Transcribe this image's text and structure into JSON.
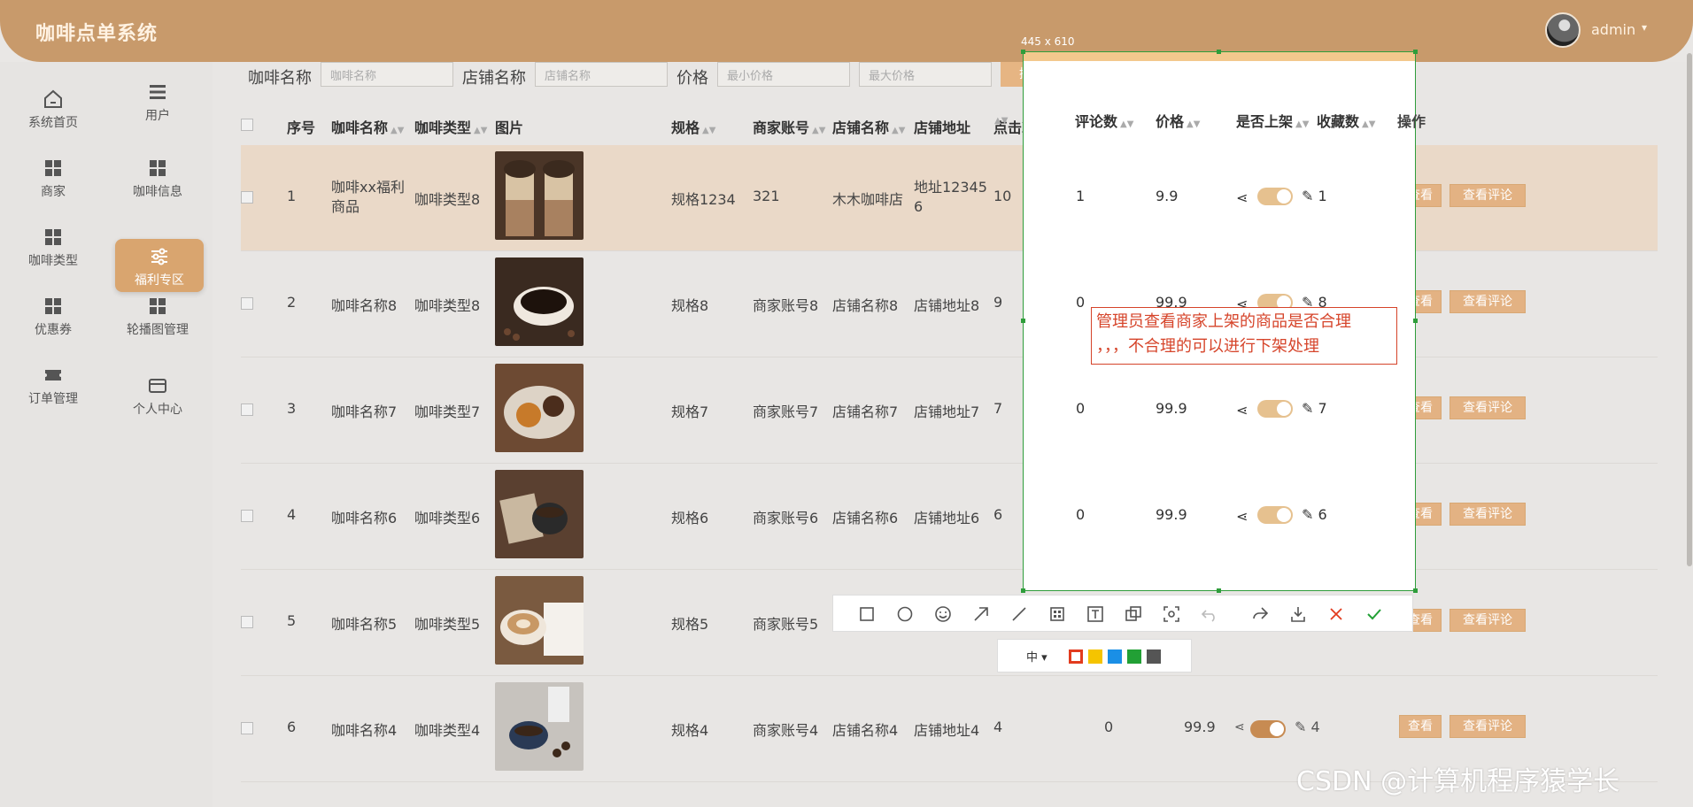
{
  "header": {
    "title": "咖啡点单系统",
    "user": "admin",
    "caret": "▾"
  },
  "sidebar": {
    "items": [
      {
        "label": "系统首页",
        "icon": "home-icon"
      },
      {
        "label": "用户",
        "icon": "menu-icon"
      },
      {
        "label": "商家",
        "icon": "grid-icon"
      },
      {
        "label": "咖啡信息",
        "icon": "grid-icon"
      },
      {
        "label": "咖啡类型",
        "icon": "grid-icon"
      },
      {
        "label": "福利专区",
        "icon": "sliders-icon"
      },
      {
        "label": "优惠券",
        "icon": "grid-icon"
      },
      {
        "label": "轮播图管理",
        "icon": "grid-icon"
      },
      {
        "label": "订单管理",
        "icon": "ticket-icon"
      },
      {
        "label": "个人中心",
        "icon": "card-icon"
      }
    ]
  },
  "search": {
    "coffee_name_label": "咖啡名称",
    "coffee_name_placeholder": "咖啡名称",
    "shop_name_label": "店铺名称",
    "shop_name_placeholder": "店铺名称",
    "price_label": "价格",
    "min_price_placeholder": "最小价格",
    "max_price_placeholder": "最大价格",
    "search_button": "搜索"
  },
  "table": {
    "headers": {
      "index": "序号",
      "name": "咖啡名称",
      "type": "咖啡类型",
      "image": "图片",
      "spec": "规格",
      "merchant": "商家账号",
      "shop": "店铺名称",
      "address": "店铺地址",
      "clicks": "点击次数",
      "comments": "评论数",
      "price": "价格",
      "listed": "是否上架",
      "favorites": "收藏数",
      "actions": "操作"
    },
    "view_label": "查看",
    "comment_label": "查看评论",
    "rows": [
      {
        "index": "1",
        "name_line1": "咖啡xx福利",
        "name_line2": "商品",
        "type": "咖啡类型8",
        "spec": "规格1234",
        "merchant": "321",
        "shop": "木木咖啡店",
        "addr_line1": "地址12345",
        "addr_line2": "6",
        "clicks": "10",
        "comments": "1",
        "price": "9.9",
        "favorites": "1"
      },
      {
        "index": "2",
        "name_line1": "咖啡名称8",
        "name_line2": "",
        "type": "咖啡类型8",
        "spec": "规格8",
        "merchant": "商家账号8",
        "shop": "店铺名称8",
        "addr_line1": "店铺地址8",
        "addr_line2": "",
        "clicks": "9",
        "comments": "0",
        "price": "99.9",
        "favorites": "8"
      },
      {
        "index": "3",
        "name_line1": "咖啡名称7",
        "name_line2": "",
        "type": "咖啡类型7",
        "spec": "规格7",
        "merchant": "商家账号7",
        "shop": "店铺名称7",
        "addr_line1": "店铺地址7",
        "addr_line2": "",
        "clicks": "7",
        "comments": "0",
        "price": "99.9",
        "favorites": "7"
      },
      {
        "index": "4",
        "name_line1": "咖啡名称6",
        "name_line2": "",
        "type": "咖啡类型6",
        "spec": "规格6",
        "merchant": "商家账号6",
        "shop": "店铺名称6",
        "addr_line1": "店铺地址6",
        "addr_line2": "",
        "clicks": "6",
        "comments": "0",
        "price": "99.9",
        "favorites": "6"
      },
      {
        "index": "5",
        "name_line1": "咖啡名称5",
        "name_line2": "",
        "type": "咖啡类型5",
        "spec": "规格5",
        "merchant": "商家账号5",
        "shop": "",
        "addr_line1": "",
        "addr_line2": "",
        "clicks": "",
        "comments": "",
        "price": "",
        "favorites": ""
      },
      {
        "index": "6",
        "name_line1": "咖啡名称4",
        "name_line2": "",
        "type": "咖啡类型4",
        "spec": "规格4",
        "merchant": "商家账号4",
        "shop": "店铺名称4",
        "addr_line1": "店铺地址4",
        "addr_line2": "",
        "clicks": "4",
        "comments": "0",
        "price": "99.9",
        "favorites": "4"
      }
    ]
  },
  "capture": {
    "size_label": "445 x 610",
    "annotation_line1": "管理员查看商家上架的商品是否合理",
    "annotation_line2": "，，，不合理的可以进行下架处理",
    "font_size_label": "中",
    "colors": [
      "#e23b1e",
      "#f5c400",
      "#1a8fe6",
      "#22a035",
      "#555555"
    ]
  },
  "share_glyph": "⋖",
  "fav_glyph": "✎",
  "watermark": "CSDN @计算机程序猿学长"
}
